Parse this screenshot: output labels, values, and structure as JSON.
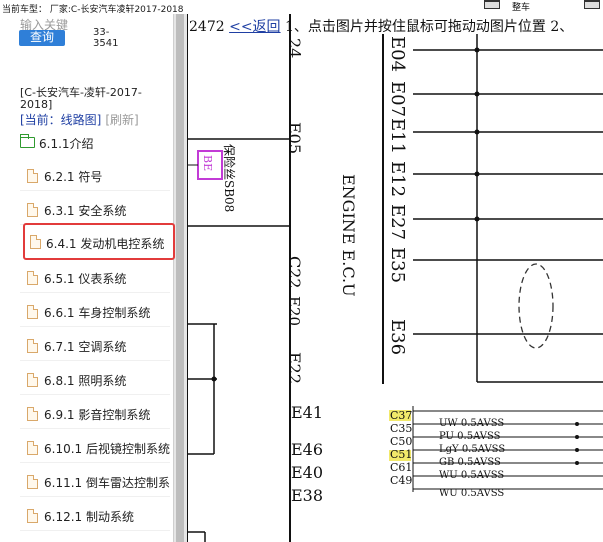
{
  "topbar": {
    "current_model_label": "当前车型：",
    "manufacturer_label": "厂家:C-长安汽车凌轩2017-2018",
    "right_label": "整车"
  },
  "search": {
    "placeholder": "输入关键",
    "button_label": "查询",
    "count_1": "33-",
    "count_2": "3541"
  },
  "sidebar": {
    "car_title": "[C-长安汽车-凌轩-2017-2018]",
    "current_label": "[当前：线路图]",
    "refresh_label": "[刷新]",
    "intro_label": "6.1.1介绍",
    "items": [
      {
        "label": "6.2.1 符号"
      },
      {
        "label": "6.3.1 安全系统"
      },
      {
        "label": "6.4.1 发动机电控系统"
      },
      {
        "label": "6.5.1 仪表系统"
      },
      {
        "label": "6.6.1 车身控制系统"
      },
      {
        "label": "6.7.1 空调系统"
      },
      {
        "label": "6.8.1 照明系统"
      },
      {
        "label": "6.9.1 影音控制系统"
      },
      {
        "label": "6.10.1 后视镜控制系统"
      },
      {
        "label": "6.11.1 倒车雷达控制系"
      },
      {
        "label": "6.12.1 制动系统"
      }
    ],
    "active_index": 2
  },
  "diagram": {
    "help_number": "2472",
    "back_link": "<<返回",
    "help_text": "1、点击图片并按住鼠标可拖动动图片位置 2、",
    "left_pins": [
      "24",
      "E05",
      "C22",
      "E20",
      "E22",
      "E41",
      "E46",
      "E40",
      "E38"
    ],
    "ecu_label": "ENGINE E.C.U",
    "fuse_label": "保险丝SB08",
    "fuse_box_label": "BE",
    "right_pins": [
      "E04",
      "E07",
      "E11",
      "E12",
      "E27",
      "E35",
      "E36"
    ],
    "wire_rows": [
      {
        "pin": "C37",
        "wire": "",
        "highlight": true
      },
      {
        "pin": "C35",
        "wire": "UW  0.5AVSS",
        "highlight": false
      },
      {
        "pin": "C50",
        "wire": "PU  0.5AVSS",
        "highlight": false
      },
      {
        "pin": "C51",
        "wire": "LgY  0.5AVSS",
        "highlight": true
      },
      {
        "pin": "C61",
        "wire": "GB  0.5AVSS",
        "highlight": false
      },
      {
        "pin": "C49",
        "wire": "WU  0.5AVSS",
        "highlight": false
      },
      {
        "pin": "",
        "wire": "WU  0.5AVSS",
        "highlight": false
      }
    ],
    "colors": {
      "highlight": "#f2e96a",
      "link": "#1f3fa3",
      "fuse_box": "#c23bd6",
      "active_border": "#e23b3b"
    }
  }
}
